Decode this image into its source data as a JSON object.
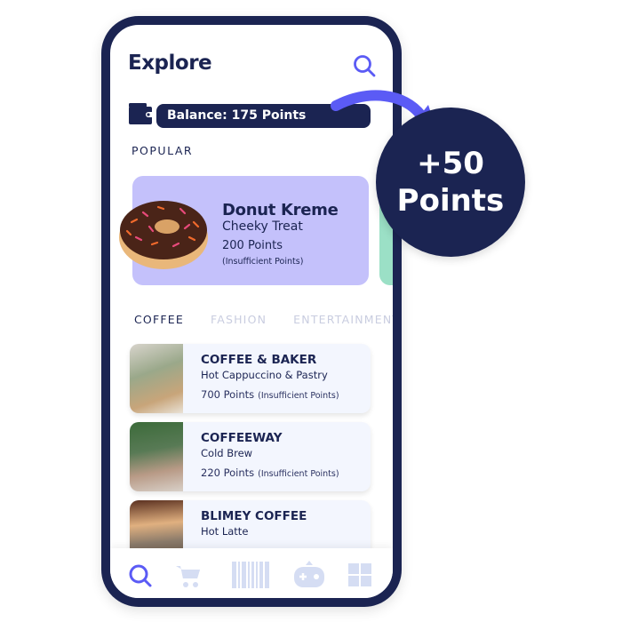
{
  "header": {
    "title": "Explore",
    "search_icon": "search-icon"
  },
  "balance": {
    "label": "Balance: 175 Points",
    "icon": "wallet-icon"
  },
  "popular": {
    "heading": "POPULAR",
    "card": {
      "name": "Donut Kreme",
      "subtitle": "Cheeky Treat",
      "points": "200 Points",
      "status": "(Insufficient Points)",
      "bg": "#c4c1fb"
    }
  },
  "tabs": [
    {
      "label": "COFFEE",
      "active": true
    },
    {
      "label": "FASHION",
      "active": false
    },
    {
      "label": "ENTERTAINMENT",
      "active": false
    }
  ],
  "list": [
    {
      "name": "COFFEE & BAKER",
      "item": "Hot Cappuccino  & Pastry",
      "points": "700 Points",
      "status": "(Insufficient Points)"
    },
    {
      "name": "COFFEEWAY",
      "item": "Cold Brew",
      "points": "220 Points",
      "status": "(Insufficient Points)"
    },
    {
      "name": "BLIMEY COFFEE",
      "item": "Hot Latte"
    }
  ],
  "nav": [
    "search-icon",
    "cart-icon",
    "barcode-icon",
    "gamepad-icon",
    "grid-icon"
  ],
  "badge": {
    "line1": "+50",
    "line2": "Points"
  },
  "colors": {
    "navy": "#1b2452",
    "accent": "#5b5bf5",
    "nav_inactive": "#d5ddf3"
  }
}
